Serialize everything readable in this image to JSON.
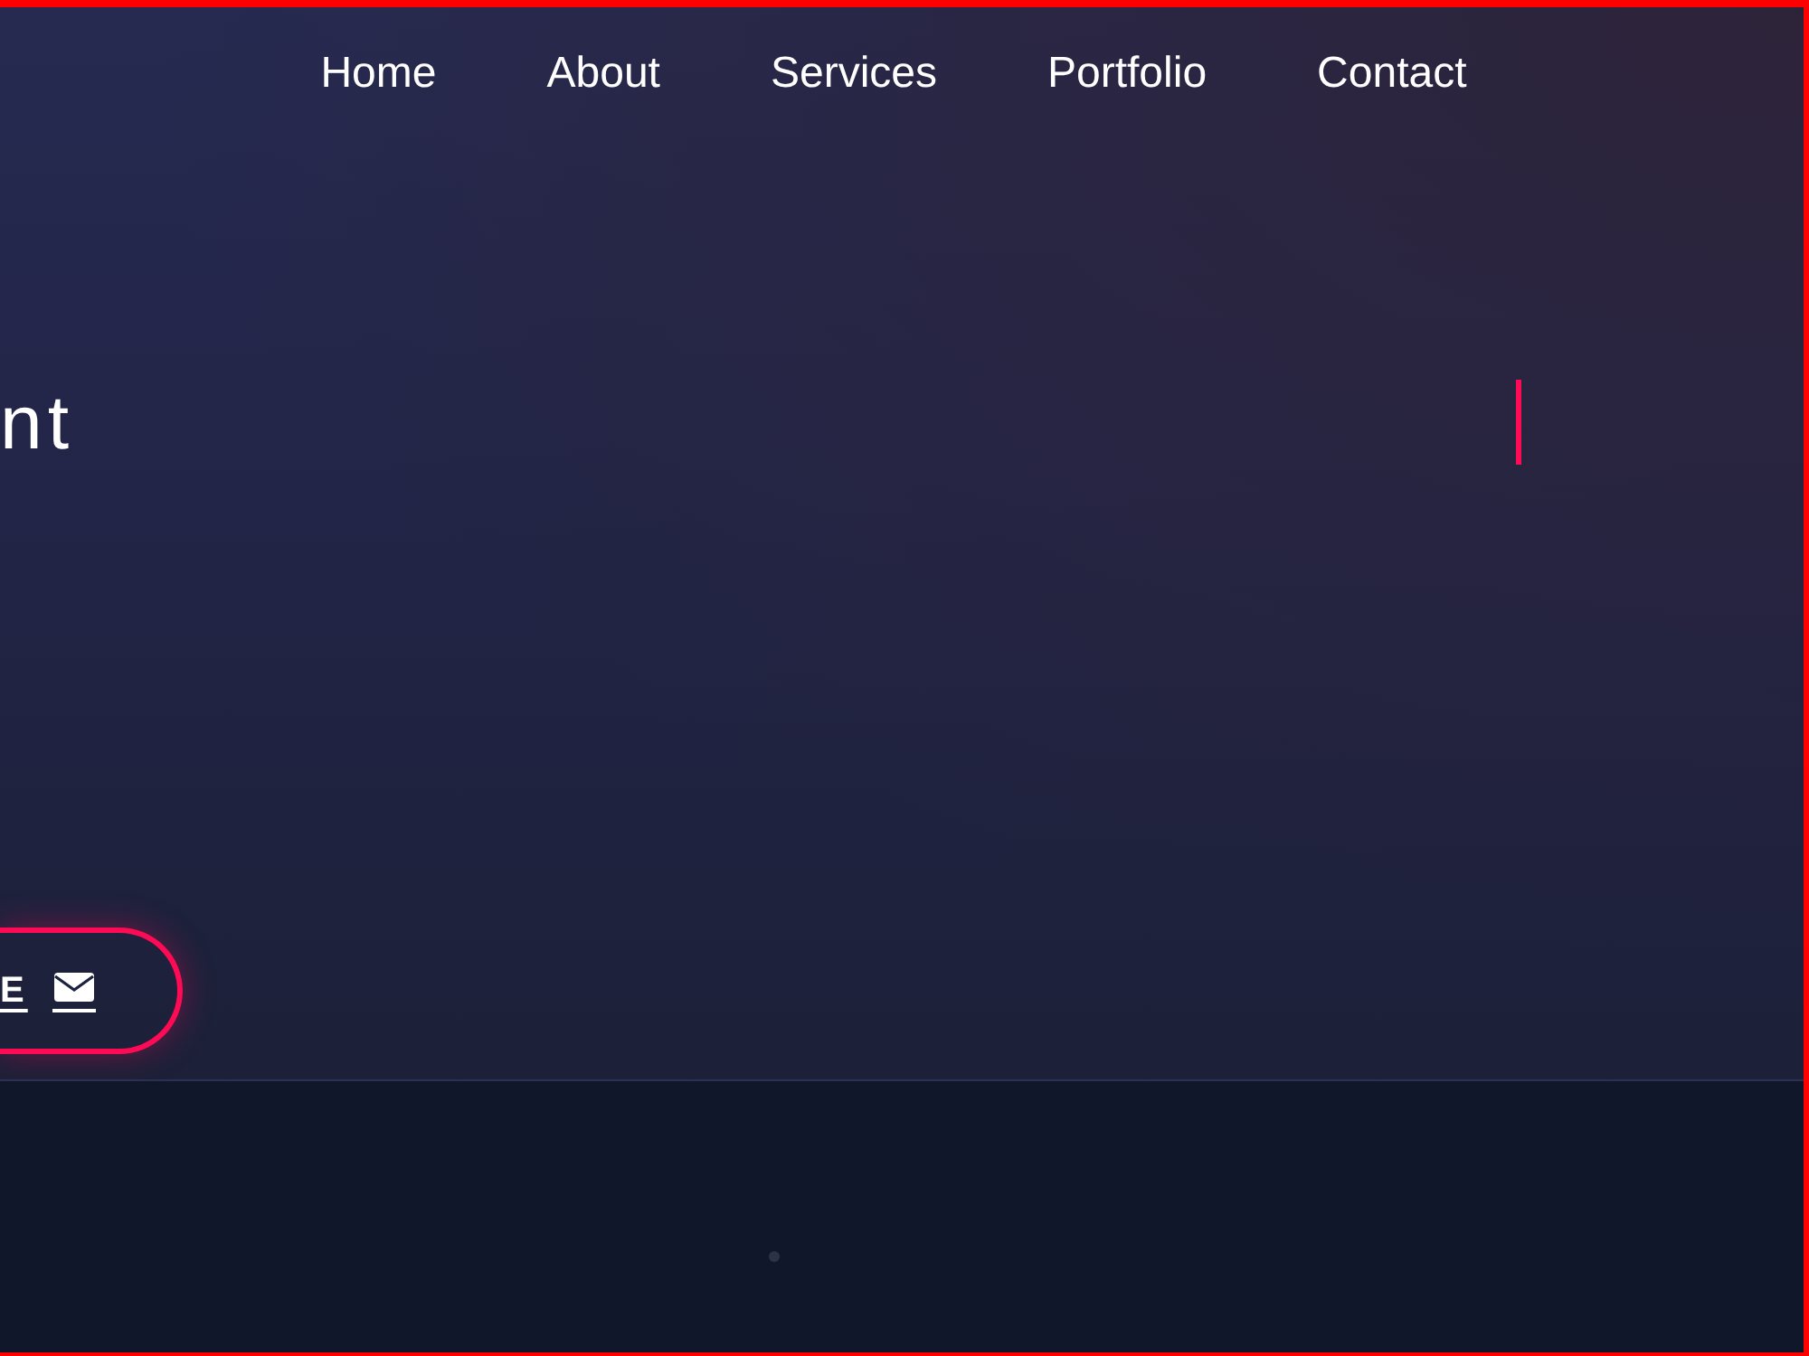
{
  "nav": {
    "links": [
      {
        "label": "Home"
      },
      {
        "label": "About"
      },
      {
        "label": "Services"
      },
      {
        "label": "Portfolio"
      },
      {
        "label": "Contact"
      }
    ]
  },
  "hero": {
    "heading": "nt",
    "button": {
      "label": "E"
    }
  }
}
